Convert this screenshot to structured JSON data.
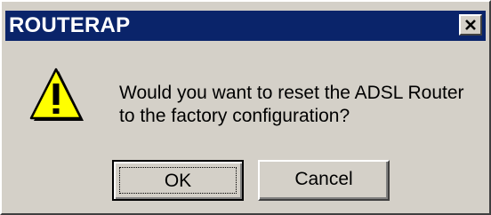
{
  "window": {
    "title": "ROUTERAP"
  },
  "message": {
    "line1": "Would you want to reset the ADSL Router",
    "line2": "to the factory configuration?"
  },
  "buttons": {
    "ok_label": "OK",
    "cancel_label": "Cancel"
  },
  "icons": {
    "warning": "warning-triangle-icon",
    "close": "close-icon"
  },
  "colors": {
    "titlebar": "#0a246a",
    "dialog_face": "#d4d0c8",
    "warning_fill": "#ffff00"
  }
}
